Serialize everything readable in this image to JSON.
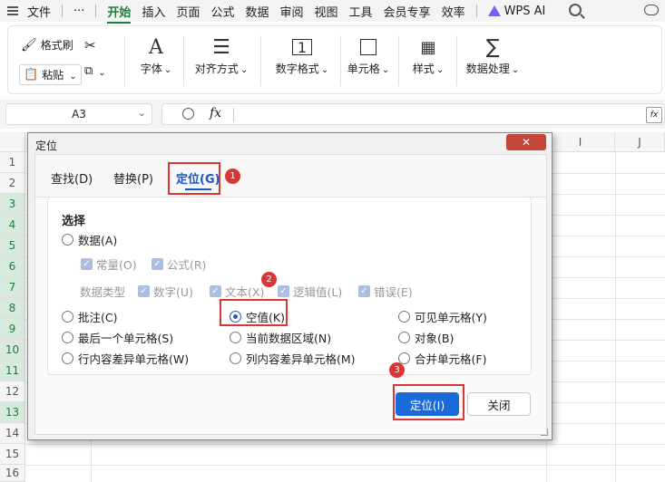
{
  "menubar": {
    "file": "文件",
    "more": "···",
    "tabs": [
      "开始",
      "插入",
      "页面",
      "公式",
      "数据",
      "审阅",
      "视图",
      "工具",
      "会员专享",
      "效率"
    ],
    "active_tab": "开始",
    "wps_ai": "WPS AI"
  },
  "ribbon": {
    "format_painter": "格式刷",
    "paste": "粘贴",
    "font": "字体",
    "align": "对齐方式",
    "number_format": "数字格式",
    "cell": "单元格",
    "style": "样式",
    "data_process": "数据处理"
  },
  "formula_bar": {
    "cell_ref": "A3",
    "fx": "fx",
    "value": ""
  },
  "grid": {
    "columns": [
      "I",
      "J"
    ],
    "rows": [
      "1",
      "2",
      "3",
      "4",
      "5",
      "6",
      "7",
      "8",
      "9",
      "10",
      "11",
      "12",
      "13",
      "14",
      "15",
      "16"
    ]
  },
  "dialog": {
    "title": "定位",
    "close_label": "✕",
    "tabs": [
      "查找(D)",
      "替换(P)",
      "定位(G)"
    ],
    "active_tab": "定位(G)",
    "section_title": "选择",
    "radio_data": "数据(A)",
    "chk_constant": "常量(O)",
    "chk_formula": "公式(R)",
    "data_type_label": "数据类型",
    "chk_number": "数字(U)",
    "chk_text": "文本(X)",
    "chk_logical": "逻辑值(L)",
    "chk_error": "错误(E)",
    "radio_comment": "批注(C)",
    "radio_blank": "空值(K)",
    "radio_visible": "可见单元格(Y)",
    "radio_last": "最后一个单元格(S)",
    "radio_current_region": "当前数据区域(N)",
    "radio_objects": "对象(B)",
    "radio_row_diff": "行内容差异单元格(W)",
    "radio_col_diff": "列内容差异单元格(M)",
    "radio_merged": "合并单元格(F)",
    "selected": "空值(K)",
    "ok_button": "定位(I)",
    "close_button": "关闭"
  },
  "annotations": [
    "1",
    "2",
    "3"
  ],
  "colors": {
    "accent_green": "#1a7f3b",
    "dialog_blue": "#1a6ad9",
    "highlight_red": "#d93636"
  }
}
